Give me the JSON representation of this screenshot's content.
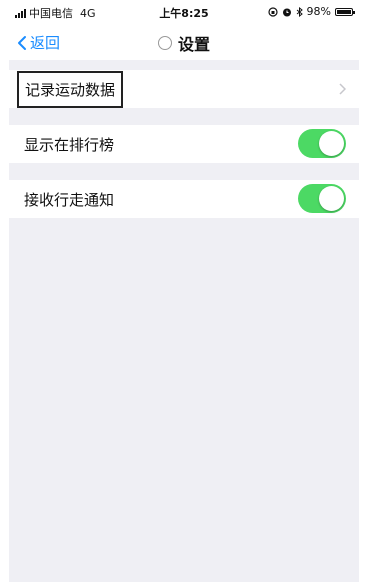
{
  "status_bar": {
    "carrier": "中国电信",
    "network": "4G",
    "time": "上午8:25",
    "battery": "98%",
    "battery_level": 0.98
  },
  "nav": {
    "back_label": "返回",
    "title": "设置"
  },
  "settings": [
    {
      "label": "记录运动数据"
    },
    {
      "label": "显示在排行榜",
      "toggle_on": true
    },
    {
      "label": "接收行走通知",
      "toggle_on": true
    }
  ],
  "colors": {
    "accent": "#1a8cff",
    "toggle_on": "#4cd964",
    "background": "#efeff4"
  }
}
